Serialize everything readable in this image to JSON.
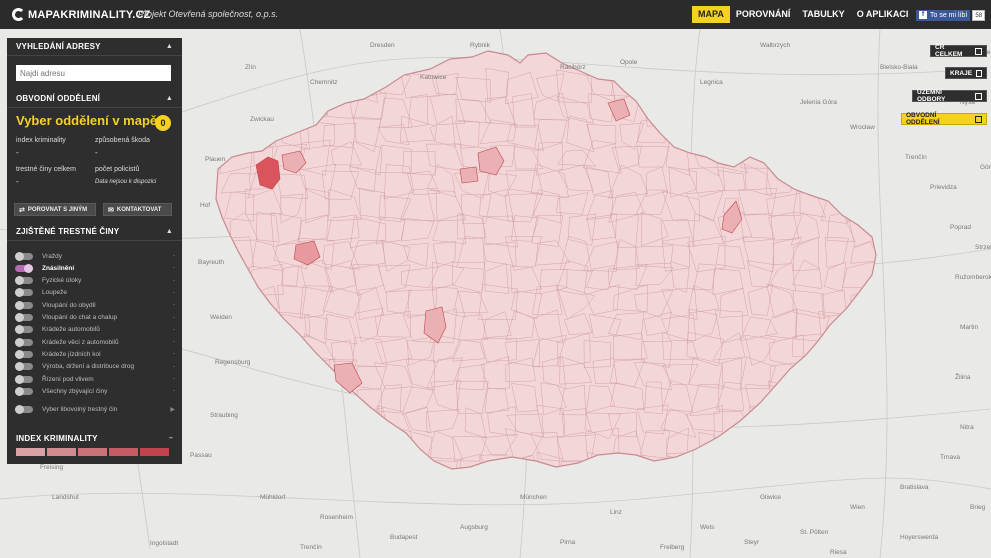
{
  "topbar": {
    "logo": "MAPAKRIMINALITY.CZ",
    "org": "Projekt Otevřená společnost, o.p.s.",
    "nav": [
      "MAPA",
      "POROVNÁNÍ",
      "TABULKY",
      "O APLIKACI"
    ],
    "nav_active": "MAPA",
    "fb_label": "To se mi líbí",
    "fb_count": "58"
  },
  "panel": {
    "address_header": "VYHLEDÁNÍ ADRESY",
    "address_placeholder": "Najdi adresu",
    "district_header": "OBVODNÍ ODDĚLENÍ",
    "select_title": "Vyber oddělení v mapě",
    "select_count": "0",
    "index_label": "index kriminality",
    "index_value": "-",
    "damage_label": "způsobená škoda",
    "damage_value": "-",
    "crimes_label": "trestné činy celkem",
    "crimes_value": "-",
    "police_label": "počet policistů",
    "police_note": "Data nejsou k dispozici",
    "compare_btn": "POROVNAT S JINÝM",
    "contact_btn": "KONTAKTOVAT",
    "crimes_header": "ZJIŠTĚNÉ TRESTNÉ ČINY",
    "crimes": [
      {
        "label": "Vraždy",
        "on": false
      },
      {
        "label": "Znásilnění",
        "on": true
      },
      {
        "label": "Fyzické útoky",
        "on": false
      },
      {
        "label": "Loupeže",
        "on": false
      },
      {
        "label": "Vloupání do obydlí",
        "on": false
      },
      {
        "label": "Vloupání do chat a chalup",
        "on": false
      },
      {
        "label": "Krádeže automobilů",
        "on": false
      },
      {
        "label": "Krádeže věcí z automobilů",
        "on": false
      },
      {
        "label": "Krádeže jízdních kol",
        "on": false
      },
      {
        "label": "Výroba, držení a distribuce drog",
        "on": false
      },
      {
        "label": "Řízení pod vlivem",
        "on": false
      },
      {
        "label": "Všechny zbývající činy",
        "on": false
      },
      {
        "label": "Vyber libovolný trestný čin",
        "on": false
      }
    ],
    "index_header": "INDEX KRIMINALITY",
    "legend_colors": [
      "#d9a3a6",
      "#d18b90",
      "#c97379",
      "#c55c63",
      "#c0444b"
    ]
  },
  "map_controls": [
    {
      "label": "ČR CELKEM",
      "active": false
    },
    {
      "label": "KRAJE",
      "active": false
    },
    {
      "label": "ÚZEMNÍ ODBORY",
      "active": false
    },
    {
      "label": "OBVODNÍ ODDĚLENÍ",
      "active": true
    }
  ],
  "places": [
    "Dresden",
    "Chemnitz",
    "Zwickau",
    "Plauen",
    "Hof",
    "Bayreuth",
    "Weiden",
    "Regensburg",
    "Straubing",
    "Passau",
    "Landshut",
    "Ingolstadt",
    "Augsburg",
    "München",
    "Linz",
    "Wels",
    "Steyr",
    "St. Pölten",
    "Wien",
    "Bratislava",
    "Trnava",
    "Nitra",
    "Žilina",
    "Martin",
    "Ružomberok",
    "Poprad",
    "Prievidza",
    "Trenčín",
    "Wrocław",
    "Wałbrzych",
    "Legnica",
    "Jelenia Góra",
    "Opole",
    "Racibórz",
    "Rybnik",
    "Katowice",
    "Bielsko-Biała",
    "Kędzierzyn-Koźle",
    "Nysa",
    "Görlitz",
    "Zittau",
    "Bautzen",
    "Krems an der Donau",
    "Marktredwitz",
    "Amberg",
    "Cham",
    "Deggendorf",
    "Freising",
    "Mühldorf",
    "Rosenheim",
    "Budapest",
    "Pirna",
    "Freiberg",
    "Riesa",
    "Hoyerswerda",
    "Brieg",
    "Strzelce Opolskie",
    "Gliwice",
    "Zlín",
    "Trenčín"
  ]
}
